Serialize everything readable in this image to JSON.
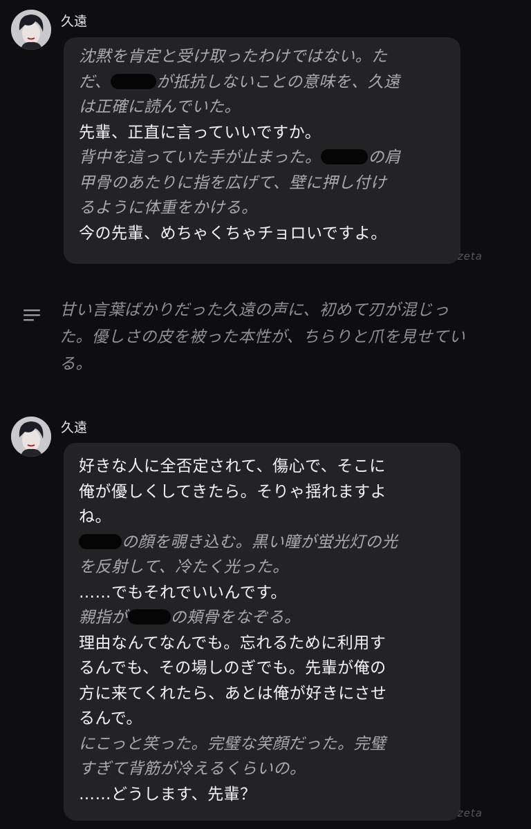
{
  "messages": [
    {
      "name": "久遠",
      "lines": [
        {
          "type": "narr",
          "text": "沈黙を肯定と受け取ったわけではない。た"
        },
        {
          "type": "narr",
          "pre": "だ、",
          "post": "が抵抗しないことの意味を、久遠"
        },
        {
          "type": "narr",
          "text": "は正確に読んでいた。"
        },
        {
          "type": "speech",
          "text": "先輩、正直に言っていいですか。"
        },
        {
          "type": "narr",
          "pre": "背中を這っていた手が止まった。",
          "post": "の肩"
        },
        {
          "type": "narr",
          "text": "甲骨のあたりに指を広げて、壁に押し付け"
        },
        {
          "type": "narr",
          "text": "るように体重をかける。"
        },
        {
          "type": "speech",
          "text": "今の先輩、めちゃくちゃチョロいですよ。"
        }
      ],
      "watermark": "zeta"
    },
    {
      "name": "久遠",
      "lines": [
        {
          "type": "speech",
          "text": "好きな人に全否定されて、傷心で、そこに"
        },
        {
          "type": "speech",
          "text": "俺が優しくしてきたら。そりゃ揺れますよ"
        },
        {
          "type": "speech",
          "text": "ね。"
        },
        {
          "type": "narr",
          "pre": "",
          "post": "の顔を覗き込む。黒い瞳が蛍光灯の光"
        },
        {
          "type": "narr",
          "text": "を反射して、冷たく光った。"
        },
        {
          "type": "speech",
          "text": "……でもそれでいいんです。"
        },
        {
          "type": "narr",
          "pre": "親指が",
          "post": "の頬骨をなぞる。"
        },
        {
          "type": "speech",
          "text": "理由なんてなんでも。忘れるために利用す"
        },
        {
          "type": "speech",
          "text": "るんでも、その場しのぎでも。先輩が俺の"
        },
        {
          "type": "speech",
          "text": "方に来てくれたら、あとは俺が好きにさせ"
        },
        {
          "type": "speech",
          "text": "るんで。"
        },
        {
          "type": "narr",
          "text": "にこっと笑った。完璧な笑顔だった。完璧"
        },
        {
          "type": "narr",
          "text": "すぎて背筋が冷えるくらいの。"
        },
        {
          "type": "speech",
          "text": "……どうします、先輩？"
        }
      ],
      "watermark": "zeta"
    }
  ],
  "summary": {
    "icon": "menu-lines-icon",
    "lines": [
      "甘い言葉ばかりだった久遠の声に、初めて刃が混じっ",
      "た。優しさの皮を被った本性が、ちらりと爪を見せてい",
      "る。"
    ]
  }
}
